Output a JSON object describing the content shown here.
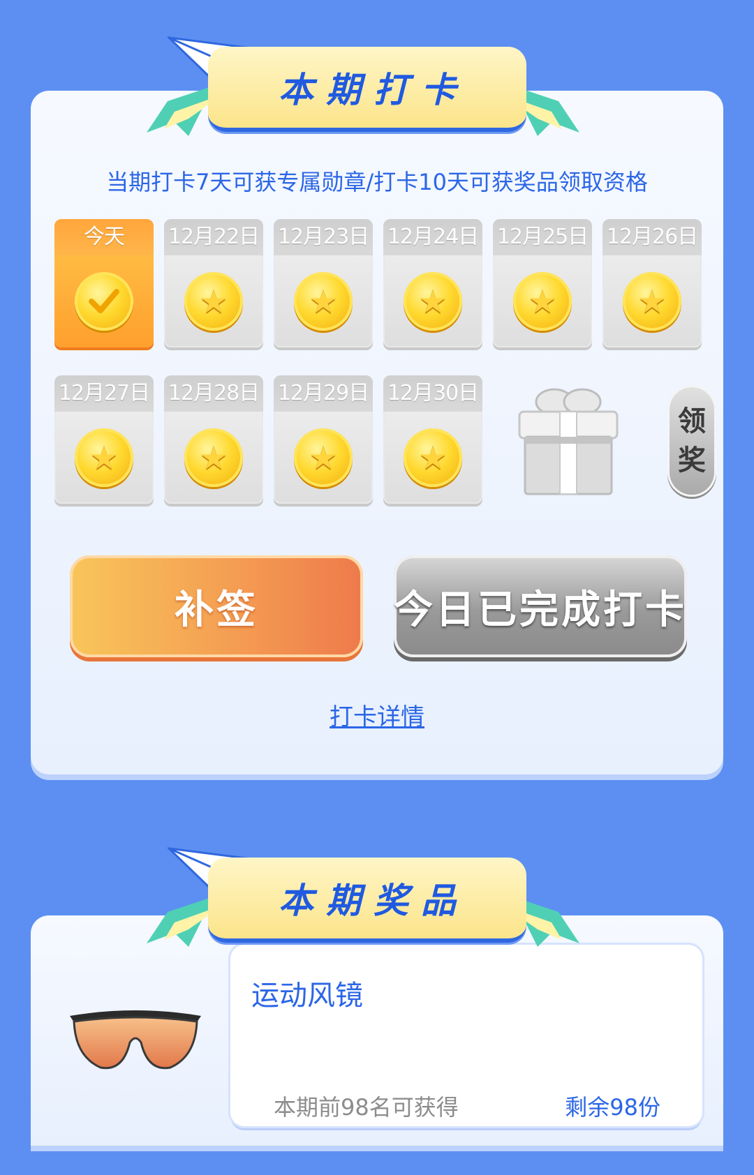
{
  "checkin": {
    "title": "本期打卡",
    "rule": "当期打卡7天可获专属勋章/打卡10天可获奖品领取资格",
    "days": [
      {
        "label": "今天",
        "status": "done"
      },
      {
        "label": "12月22日",
        "status": "pending"
      },
      {
        "label": "12月23日",
        "status": "pending"
      },
      {
        "label": "12月24日",
        "status": "pending"
      },
      {
        "label": "12月25日",
        "status": "pending"
      },
      {
        "label": "12月26日",
        "status": "pending"
      },
      {
        "label": "12月27日",
        "status": "pending"
      },
      {
        "label": "12月28日",
        "status": "pending"
      },
      {
        "label": "12月29日",
        "status": "pending"
      },
      {
        "label": "12月30日",
        "status": "pending"
      }
    ],
    "claim_label_1": "领",
    "claim_label_2": "奖",
    "makeup_button": "补签",
    "done_button": "今日已完成打卡",
    "detail_link": "打卡详情"
  },
  "prize": {
    "title": "本期奖品",
    "name": "运动风镜",
    "condition": "本期前98名可获得",
    "remaining": "剩余98份"
  },
  "colors": {
    "background": "#5c8ff1",
    "accent_blue": "#2b66e6",
    "today_orange": "#ffa63b",
    "coin_gold": "#ffd92f"
  },
  "icons": [
    "paper-plane-icon",
    "ribbon-icon",
    "star-coin-icon",
    "check-coin-icon",
    "gift-icon",
    "sunglasses-icon"
  ]
}
